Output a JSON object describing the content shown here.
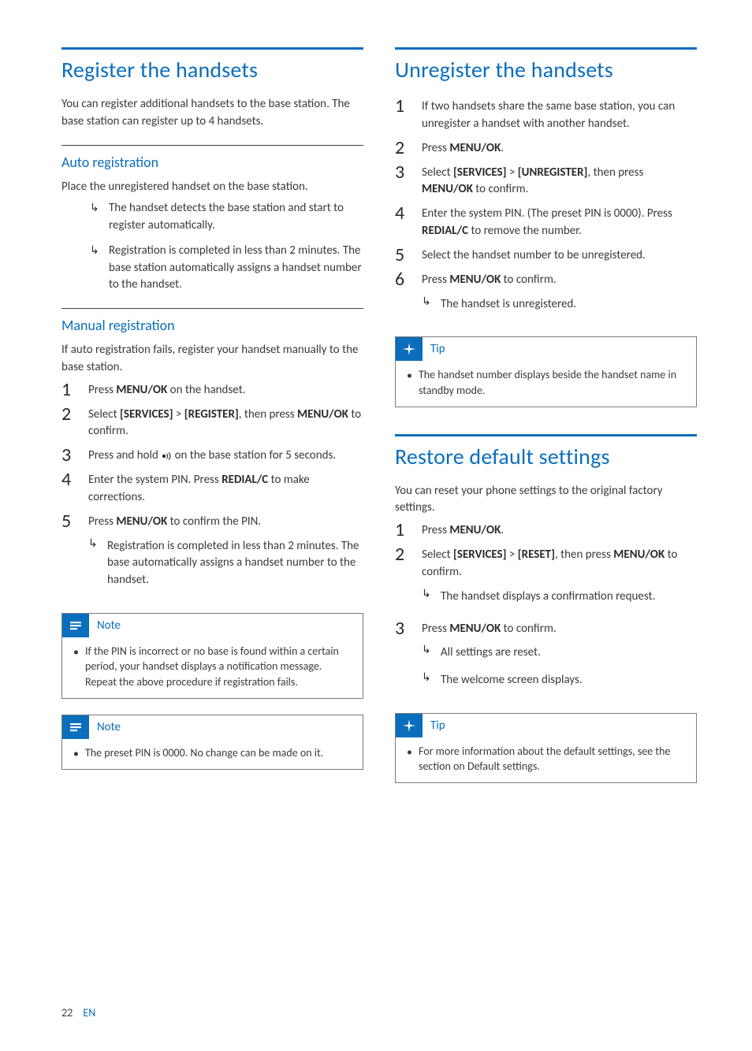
{
  "footer": {
    "page": "22",
    "lang": "EN"
  },
  "left": {
    "h1": "Register the handsets",
    "intro": "You can register additional handsets to the base station. The base station can register up to 4 handsets.",
    "auto": {
      "title": "Auto registration",
      "lead": "Place the unregistered handset on the base station.",
      "arrows": [
        "The handset detects the base station and start to register automatically.",
        "Registration is completed in less than 2 minutes. The base station automatically assigns a handset number to the handset."
      ]
    },
    "manual": {
      "title": "Manual registration",
      "lead": "If auto registration fails, register your handset manually to the base station.",
      "steps": [
        {
          "n": "1",
          "pre": "Press ",
          "b1": "MENU/OK",
          "post": " on the handset."
        },
        {
          "n": "2",
          "pre": "Select ",
          "b1": "[SERVICES]",
          "mid": " > ",
          "b2": "[REGISTER]",
          "post": ", then press ",
          "b3": "MENU/OK",
          "tail": " to confirm."
        },
        {
          "n": "3",
          "pre": "Press and hold ",
          "icon": "page",
          "post": " on the base station for 5 seconds."
        },
        {
          "n": "4",
          "pre": "Enter the system PIN. Press ",
          "b1": "REDIAL/C",
          "post": " to make corrections."
        },
        {
          "n": "5",
          "pre": "Press ",
          "b1": "MENU/OK",
          "post": " to confirm the PIN.",
          "arrows": [
            "Registration is completed in less than 2 minutes. The base automatically assigns a handset number to the handset."
          ]
        }
      ]
    },
    "note1": {
      "title": "Note",
      "text": "If the PIN is incorrect or no base is found within a certain period, your handset displays a notification message. Repeat the above procedure if registration fails."
    },
    "note2": {
      "title": "Note",
      "text": "The preset PIN is 0000. No change can be made on it."
    }
  },
  "right": {
    "h1a": "Unregister the handsets",
    "stepsA": [
      {
        "n": "1",
        "plain": "If two handsets share the same base station, you can unregister a handset with another handset."
      },
      {
        "n": "2",
        "pre": "Press ",
        "b1": "MENU/OK",
        "post": "."
      },
      {
        "n": "3",
        "pre": "Select ",
        "b1": "[SERVICES]",
        "mid": " > ",
        "b2": "[UNREGISTER]",
        "post": ", then press ",
        "b3": "MENU/OK",
        "tail": " to confirm."
      },
      {
        "n": "4",
        "pre": "Enter the system PIN. (The preset PIN is 0000). Press ",
        "b1": "REDIAL/C",
        "post": " to remove the number."
      },
      {
        "n": "5",
        "plain": "Select the handset number to be unregistered."
      },
      {
        "n": "6",
        "pre": "Press ",
        "b1": "MENU/OK",
        "post": " to confirm.",
        "arrows": [
          "The handset is unregistered."
        ]
      }
    ],
    "tip1": {
      "title": "Tip",
      "text": "The handset number displays beside the handset name in standby mode."
    },
    "h1b": "Restore default settings",
    "introB": "You can reset your phone settings to the original factory settings.",
    "stepsB": [
      {
        "n": "1",
        "pre": "Press ",
        "b1": "MENU/OK",
        "post": "."
      },
      {
        "n": "2",
        "pre": "Select ",
        "b1": "[SERVICES]",
        "mid": " > ",
        "b2": "[RESET]",
        "post": ", then press ",
        "b3": "MENU/OK",
        "tail": " to confirm.",
        "arrows": [
          "The handset displays a confirmation request."
        ]
      },
      {
        "n": "3",
        "pre": "Press ",
        "b1": "MENU/OK",
        "post": " to confirm.",
        "arrows": [
          "All settings are reset.",
          "The welcome screen displays."
        ]
      }
    ],
    "tip2": {
      "title": "Tip",
      "text": "For more information about the default settings, see the section on Default settings."
    }
  }
}
